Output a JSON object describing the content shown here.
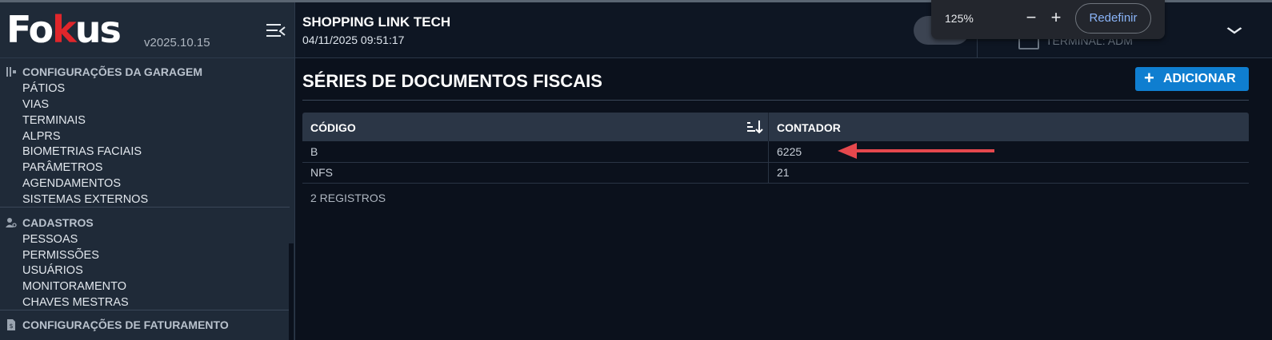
{
  "app": {
    "logo_prefix": "Fo",
    "logo_mark": "k",
    "logo_suffix": "us",
    "version": "v2025.10.15",
    "logo_accent": "#e0262b"
  },
  "header": {
    "company": "SHOPPING LINK TECH",
    "datetime": "04/11/2025 09:51:17",
    "terminal_label": "TERMINAL: ADM"
  },
  "zoom_popup": {
    "level": "125%",
    "minus": "−",
    "plus": "+",
    "reset_label": "Redefinir"
  },
  "sidebar": {
    "sections": [
      {
        "title": "CONFIGURAÇÕES DA GARAGEM",
        "icon": "garage-config-icon",
        "items": [
          "PÁTIOS",
          "VIAS",
          "TERMINAIS",
          "ALPRS",
          "BIOMETRIAS FACIAIS",
          "PARÂMETROS",
          "AGENDAMENTOS",
          "SISTEMAS EXTERNOS"
        ]
      },
      {
        "title": "CADASTROS",
        "icon": "user-search-icon",
        "items": [
          "PESSOAS",
          "PERMISSÕES",
          "USUÁRIOS",
          "MONITORAMENTO",
          "CHAVES MESTRAS"
        ]
      },
      {
        "title": "CONFIGURAÇÕES DE FATURAMENTO",
        "icon": "invoice-icon",
        "items": []
      }
    ]
  },
  "main": {
    "title": "SÉRIES DE DOCUMENTOS FISCAIS",
    "add_button": "ADICIONAR",
    "add_icon": "+",
    "columns": [
      "CÓDIGO",
      "CONTADOR"
    ],
    "rows": [
      {
        "codigo": "B",
        "contador": "6225"
      },
      {
        "codigo": "NFS",
        "contador": "21"
      }
    ],
    "records": "2 REGISTROS",
    "accent": "#0f7ed0",
    "annotation_color": "#e5484d"
  }
}
